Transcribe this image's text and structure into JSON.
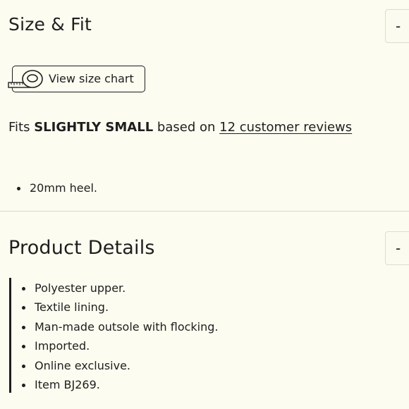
{
  "size_fit": {
    "title": "Size & Fit",
    "toggle": "-",
    "size_chart_label": "View size chart",
    "fit": {
      "prefix": "Fits",
      "emphasis": "SLIGHTLY SMALL",
      "middle": "based on",
      "reviews_link": "12 customer reviews"
    },
    "bullets": [
      "20mm heel."
    ]
  },
  "product_details": {
    "title": "Product Details",
    "toggle": "-",
    "bullets": [
      "Polyester upper.",
      "Textile lining.",
      "Man-made outsole with flocking.",
      "Imported.",
      "Online exclusive.",
      "Item BJ269."
    ]
  }
}
